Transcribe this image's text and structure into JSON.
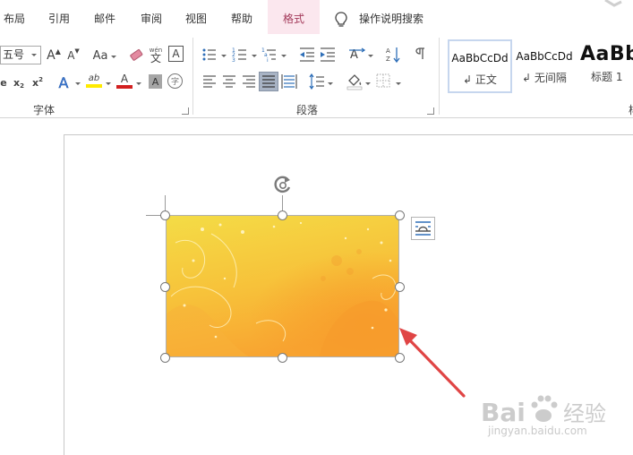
{
  "tabs": [
    {
      "label": "布局"
    },
    {
      "label": "引用"
    },
    {
      "label": "邮件"
    },
    {
      "label": "审阅"
    },
    {
      "label": "视图"
    },
    {
      "label": "帮助"
    },
    {
      "label": "格式",
      "active": true
    }
  ],
  "tell_me": "操作说明搜索",
  "font_group": {
    "label": "字体",
    "font_size": "五号",
    "grow_font_glyph": "A",
    "shrink_font_glyph": "A",
    "change_case_glyph": "Aa",
    "phonetic_glyph": "文",
    "phonetic_top": "wén",
    "border_glyph": "A",
    "strike_glyph": "e",
    "subscript_glyph": "x",
    "superscript_glyph": "x",
    "subscript_small": "2",
    "superscript_small": "2",
    "text_effect_glyph": "A",
    "highlight_glyph": "ab",
    "font_color_glyph": "A",
    "shading_glyph": "A",
    "enclose_glyph": "字"
  },
  "paragraph_group": {
    "label": "段落"
  },
  "styles_group": {
    "label_fragment": "样",
    "items": [
      {
        "preview": "AaBbCcDd",
        "name": "正文",
        "selected": true
      },
      {
        "preview": "AaBbCcDd",
        "name": "无间隔"
      },
      {
        "preview": "AaBb",
        "name": "标题 1"
      }
    ]
  },
  "watermark": {
    "brand": "Bai",
    "brand_cn": "经验",
    "url": "jingyan.baidu.com"
  },
  "colors": {
    "active_tab_bg": "#fbe7ee",
    "highlight_yellow": "#ffeb00",
    "font_color_red": "#d21f1f",
    "arrow_red": "#e04545",
    "picture_top": "#f4dc46",
    "picture_bottom": "#f8a531"
  }
}
